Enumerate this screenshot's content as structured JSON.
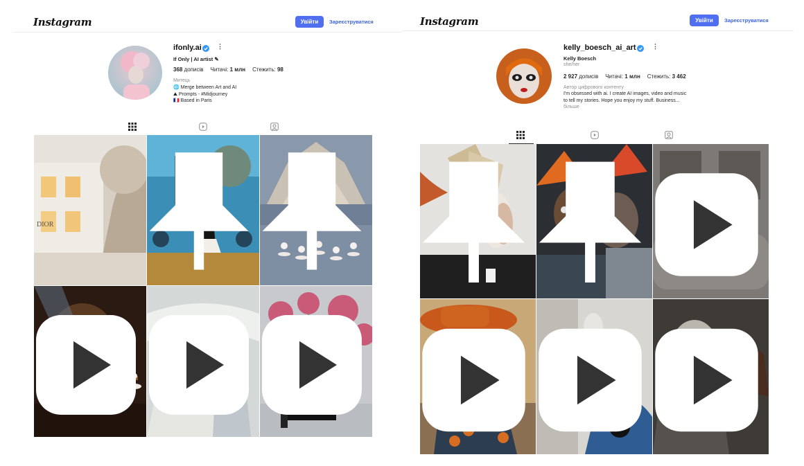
{
  "left_profile": {
    "logo": "Instagram",
    "login_label": "Увійти",
    "signup_label": "Зареєструватися",
    "username": "ifonly.ai",
    "full_name": "If Only | AI artist ✎",
    "posts_count": "368",
    "posts_label": "дописів",
    "followers_label": "Читачі:",
    "followers_count": "1 млн",
    "following_label": "Стежить:",
    "following_count": "98",
    "category": "Митець",
    "bio_lines": [
      "🌐 Merge between Art and AI",
      "⛰ Prompts - #Midjourney",
      "🇫🇷 Based in Paris"
    ],
    "tiles": [
      {
        "name": "dior-palace",
        "overlay": "none"
      },
      {
        "name": "versace-underwater",
        "overlay": "pin-icon"
      },
      {
        "name": "ballet-tent",
        "overlay": "pin-icon"
      },
      {
        "name": "mechanical-stage",
        "overlay": "reel-icon"
      },
      {
        "name": "lace-man",
        "overlay": "reel-icon"
      },
      {
        "name": "piano-flowers",
        "overlay": "reel-icon"
      }
    ]
  },
  "right_profile": {
    "logo": "Instagram",
    "login_label": "Увійти",
    "signup_label": "Зареєструватися",
    "username": "kelly_boesch_ai_art",
    "full_name": "Kelly Boesch",
    "pronouns": "she/her",
    "posts_count": "2 927",
    "posts_label": "дописів",
    "followers_label": "Читачі:",
    "followers_count": "1 млн",
    "following_label": "Стежить:",
    "following_count": "3 462",
    "category": "Автор цифрового контенту",
    "bio_lines": [
      "I'm obsessed with ai. I create AI images, video and music",
      "to tell my stories. Hope you enjoy my stuff. Business..."
    ],
    "more_label": "більше",
    "tiles": [
      {
        "name": "paper-headdress",
        "overlay": "pin-icon"
      },
      {
        "name": "painted-faces",
        "overlay": "pin-icon"
      },
      {
        "name": "mannequins-car",
        "overlay": "reel-icon"
      },
      {
        "name": "orange-hat-woman",
        "overlay": "reel-icon"
      },
      {
        "name": "collage-figure",
        "overlay": "reel-icon"
      },
      {
        "name": "pale-man-woman",
        "overlay": "reel-icon"
      }
    ]
  },
  "colors": {
    "accent": "#4f6ff0",
    "verified": "#3897f0"
  }
}
